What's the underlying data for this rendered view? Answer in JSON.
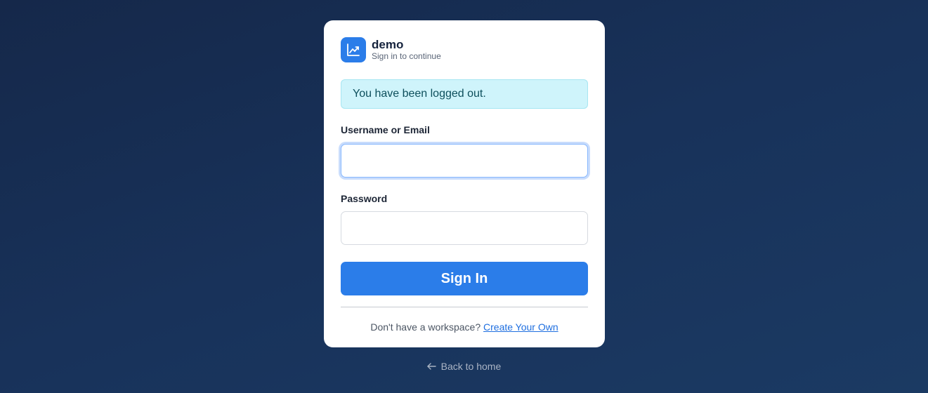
{
  "brand": {
    "name": "demo",
    "subtitle": "Sign in to continue",
    "logo_icon": "line-chart-icon",
    "accent_color": "#2b7de9"
  },
  "alert": {
    "message": "You have been logged out."
  },
  "form": {
    "username_label": "Username or Email",
    "username_value": "",
    "password_label": "Password",
    "password_value": "",
    "submit_label": "Sign In"
  },
  "footer": {
    "prompt": "Don't have a workspace?",
    "link_label": "Create Your Own"
  },
  "back": {
    "icon": "arrow-left-icon",
    "label": "Back to home"
  }
}
